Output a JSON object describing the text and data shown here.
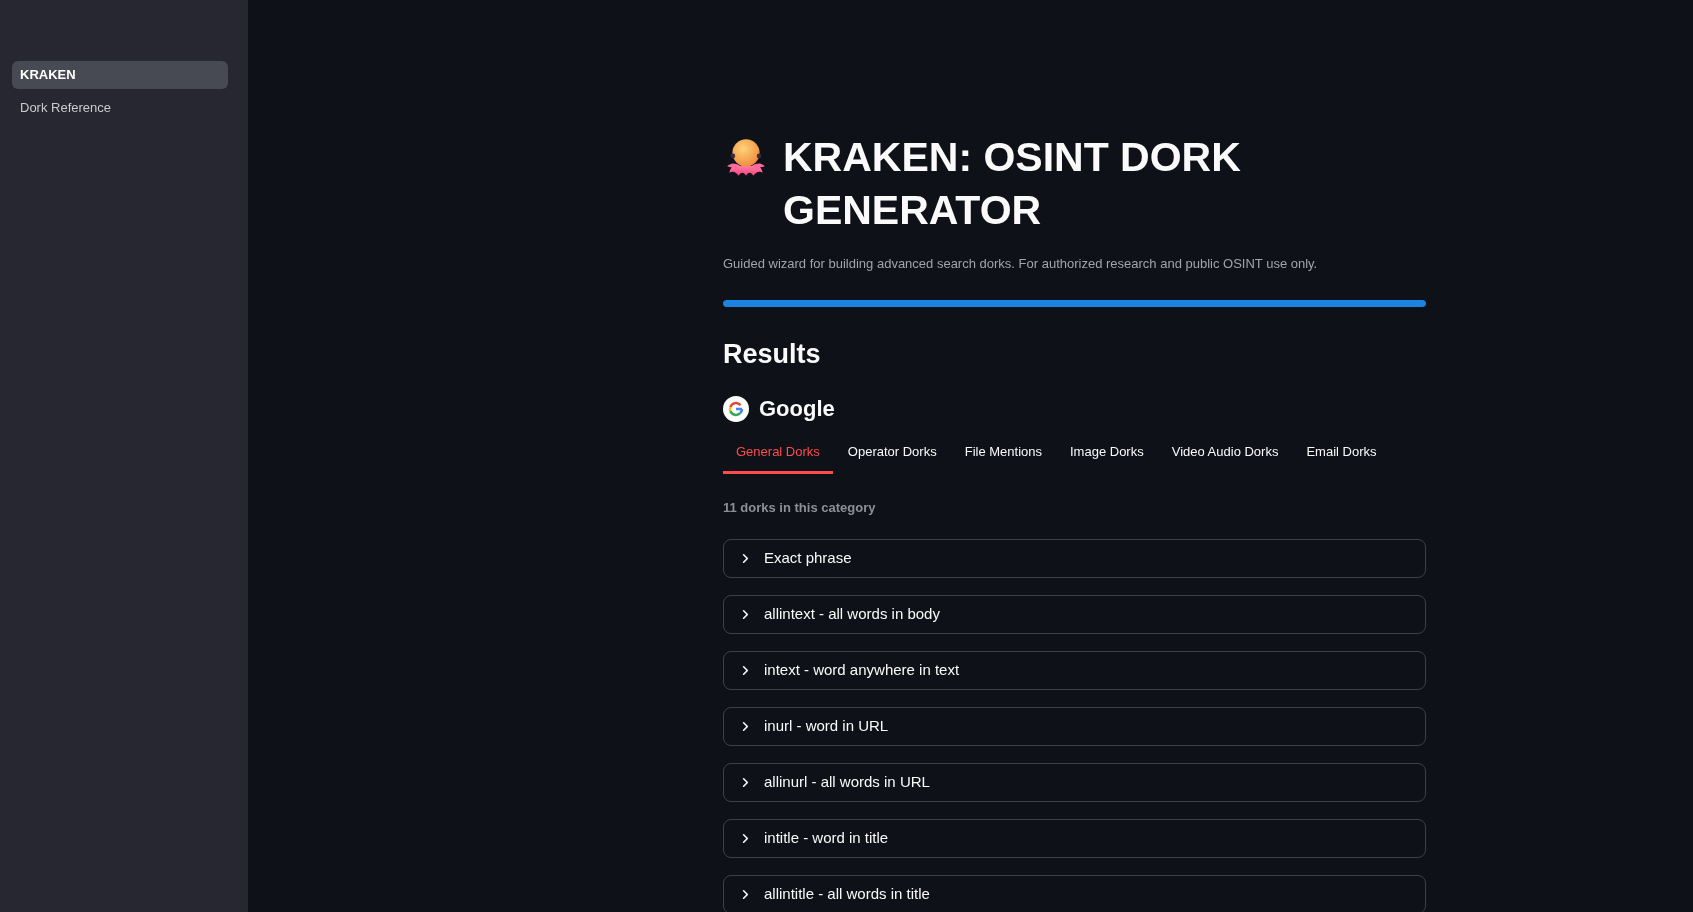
{
  "sidebar": {
    "items": [
      {
        "label": "KRAKEN",
        "selected": true
      },
      {
        "label": "Dork Reference",
        "selected": false
      }
    ]
  },
  "header": {
    "title": "KRAKEN: OSINT DORK GENERATOR",
    "subtitle": "Guided wizard for building advanced search dorks. For authorized research and public OSINT use only.",
    "progress": {
      "level": 1
    }
  },
  "results": {
    "heading": "Results",
    "engine": {
      "name": "Google"
    },
    "tabs": [
      {
        "label": "General Dorks",
        "selected": true
      },
      {
        "label": "Operator Dorks",
        "selected": false
      },
      {
        "label": "File Mentions",
        "selected": false
      },
      {
        "label": "Image Dorks",
        "selected": false
      },
      {
        "label": "Video Audio Dorks",
        "selected": false
      },
      {
        "label": "Email Dorks",
        "selected": false
      }
    ],
    "count_text": "11 dorks in this category",
    "dorks": [
      {
        "label": "Exact phrase",
        "expanded": false
      },
      {
        "label": "allintext - all words in body",
        "expanded": false
      },
      {
        "label": "intext - word anywhere in text",
        "expanded": false
      },
      {
        "label": "inurl - word in URL",
        "expanded": false
      },
      {
        "label": "allinurl - all words in URL",
        "expanded": false
      },
      {
        "label": "intitle - word in title",
        "expanded": false
      },
      {
        "label": "allintitle - all words in title",
        "expanded": false
      }
    ]
  }
}
